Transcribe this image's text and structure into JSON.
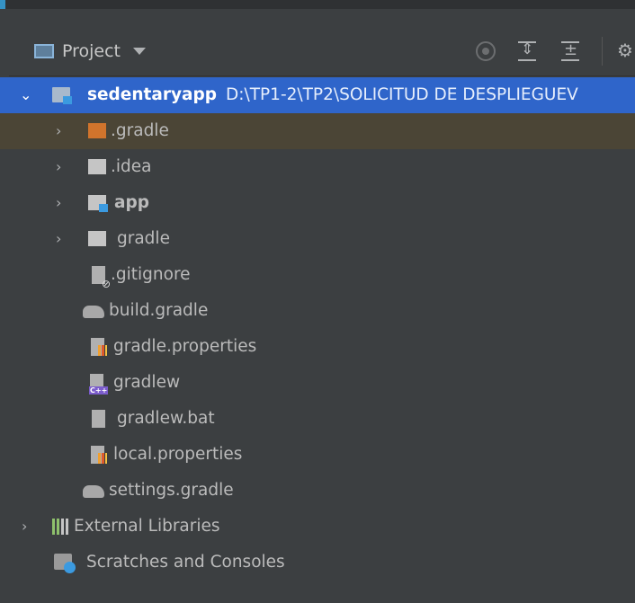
{
  "toolbar": {
    "title": "Project",
    "icons": [
      "project-icon",
      "dropdown-arrow-icon",
      "locate-icon",
      "expand-all-icon",
      "collapse-all-icon",
      "gear-icon"
    ]
  },
  "tree": {
    "root": {
      "name": "sedentaryapp",
      "path": "D:\\TP1-2\\TP2\\SOLICITUD DE DESPLIEGUEV"
    },
    "folders": [
      ".gradle",
      ".idea",
      "app",
      "gradle"
    ],
    "files": [
      ".gitignore",
      "build.gradle",
      "gradle.properties",
      "gradlew",
      "gradlew.bat",
      "local.properties",
      "settings.gradle"
    ],
    "external_libraries": "External Libraries",
    "scratches": "Scratches and Consoles"
  },
  "colors": {
    "background": "#3c3f41",
    "selection": "#2f65ca",
    "highlight_row": "#4b4536",
    "module_accent": "#3b9ae0"
  }
}
